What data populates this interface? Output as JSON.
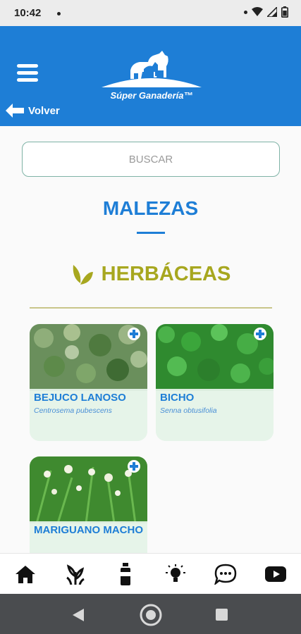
{
  "status_bar": {
    "time": "10:42"
  },
  "header": {
    "brand": "Súper Ganadería™",
    "back_label": "Volver"
  },
  "search": {
    "placeholder": "BUSCAR"
  },
  "page": {
    "title": "MALEZAS"
  },
  "category": {
    "label": "HERBÁCEAS"
  },
  "cards": [
    {
      "name": "BEJUCO LANOSO",
      "scientific": "Centrosema pubescens"
    },
    {
      "name": "BICHO",
      "scientific": "Senna obtusifolia"
    },
    {
      "name": "MARIGUANO MACHO",
      "scientific": ""
    }
  ],
  "bottom_nav": {
    "items": [
      "home-icon",
      "weeds-icon",
      "product-bottle-icon",
      "lightbulb-icon",
      "chat-icon",
      "youtube-icon"
    ]
  },
  "colors": {
    "primary": "#1e7ed6",
    "category": "#a7a71f",
    "system_nav": "#4a4c4f"
  }
}
